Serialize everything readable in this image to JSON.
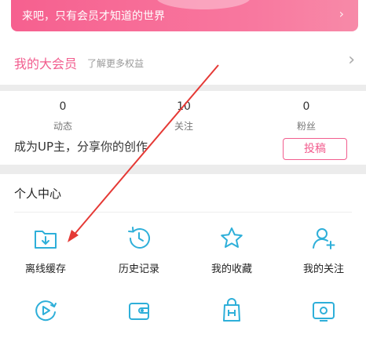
{
  "vip_banner": {
    "text": "来吧，只有会员才知道的世界",
    "arrow": "›",
    "color": "#f8709a"
  },
  "big_vip": {
    "title": "我的大会员",
    "subtitle": "了解更多权益",
    "arrow": "›",
    "title_color": "#f25d8e"
  },
  "stats": {
    "items": [
      {
        "count": "0",
        "label": "动态"
      },
      {
        "count": "10",
        "label": "关注"
      },
      {
        "count": "0",
        "label": "粉丝"
      }
    ],
    "obscured_text": "成为UP主，分享你的创作",
    "obscured_button": "投稿"
  },
  "personal_center": {
    "title": "个人中心",
    "items": [
      {
        "label": "离线缓存",
        "icon": "download-folder-icon"
      },
      {
        "label": "历史记录",
        "icon": "history-clock-icon"
      },
      {
        "label": "我的收藏",
        "icon": "star-icon"
      },
      {
        "label": "我的关注",
        "icon": "add-user-icon"
      },
      {
        "label": "",
        "icon": "play-later-icon"
      },
      {
        "label": "",
        "icon": "wallet-icon"
      },
      {
        "label": "",
        "icon": "shopping-bag-icon"
      },
      {
        "label": "",
        "icon": "tv-icon"
      }
    ],
    "accent_color": "#2eafd9"
  },
  "annotation": {
    "arrow_color": "#e53935"
  }
}
